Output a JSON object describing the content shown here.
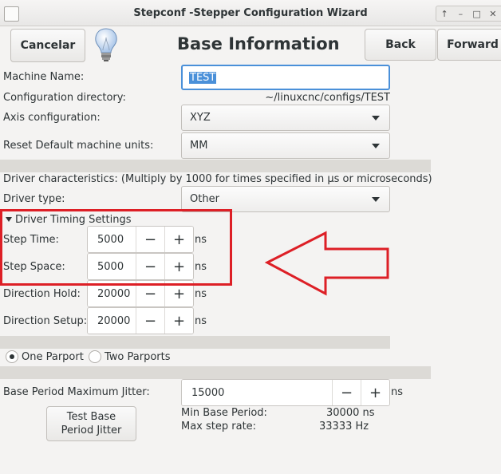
{
  "window": {
    "title": "Stepconf -Stepper Configuration Wizard",
    "controls": [
      "↑",
      "–",
      "□",
      "✕"
    ]
  },
  "header": {
    "cancel_label": "Cancelar",
    "title": "Base Information",
    "back_label": "Back",
    "forward_label": "Forward"
  },
  "machine_name": {
    "label": "Machine Name:",
    "value": "TEST"
  },
  "config_dir": {
    "label": "Configuration directory:",
    "value": "~/linuxcnc/configs/TEST"
  },
  "axis_config": {
    "label": "Axis configuration:",
    "value": "XYZ"
  },
  "units": {
    "label": "Reset Default machine units:",
    "value": "MM"
  },
  "driver": {
    "characteristics_text": "Driver characteristics: (Multiply by 1000 for times specified in µs or microseconds)",
    "type_label": "Driver type:",
    "type_value": "Other"
  },
  "timing": {
    "expander_label": "Driver Timing Settings",
    "unit": "ns",
    "rows": [
      {
        "label": "Step Time:",
        "value": "5000"
      },
      {
        "label": "Step Space:",
        "value": "5000"
      },
      {
        "label": "Direction Hold:",
        "value": "20000"
      },
      {
        "label": "Direction Setup:",
        "value": "20000"
      }
    ]
  },
  "parport": {
    "one_label": "One Parport",
    "two_label": "Two Parports",
    "selected": "one"
  },
  "jitter": {
    "label": "Base Period Maximum Jitter:",
    "value": "15000",
    "unit": "ns",
    "test_button_label": "Test Base\nPeriod Jitter",
    "min_period_label": "Min Base Period:",
    "min_period_value": "30000 ns",
    "max_rate_label": "Max step rate:",
    "max_rate_value": "33333 Hz"
  },
  "spin": {
    "minus": "−",
    "plus": "+"
  },
  "colors": {
    "accent": "#4a90d9",
    "annotation": "#dd1f26",
    "bulb": "#b9d2ef"
  }
}
